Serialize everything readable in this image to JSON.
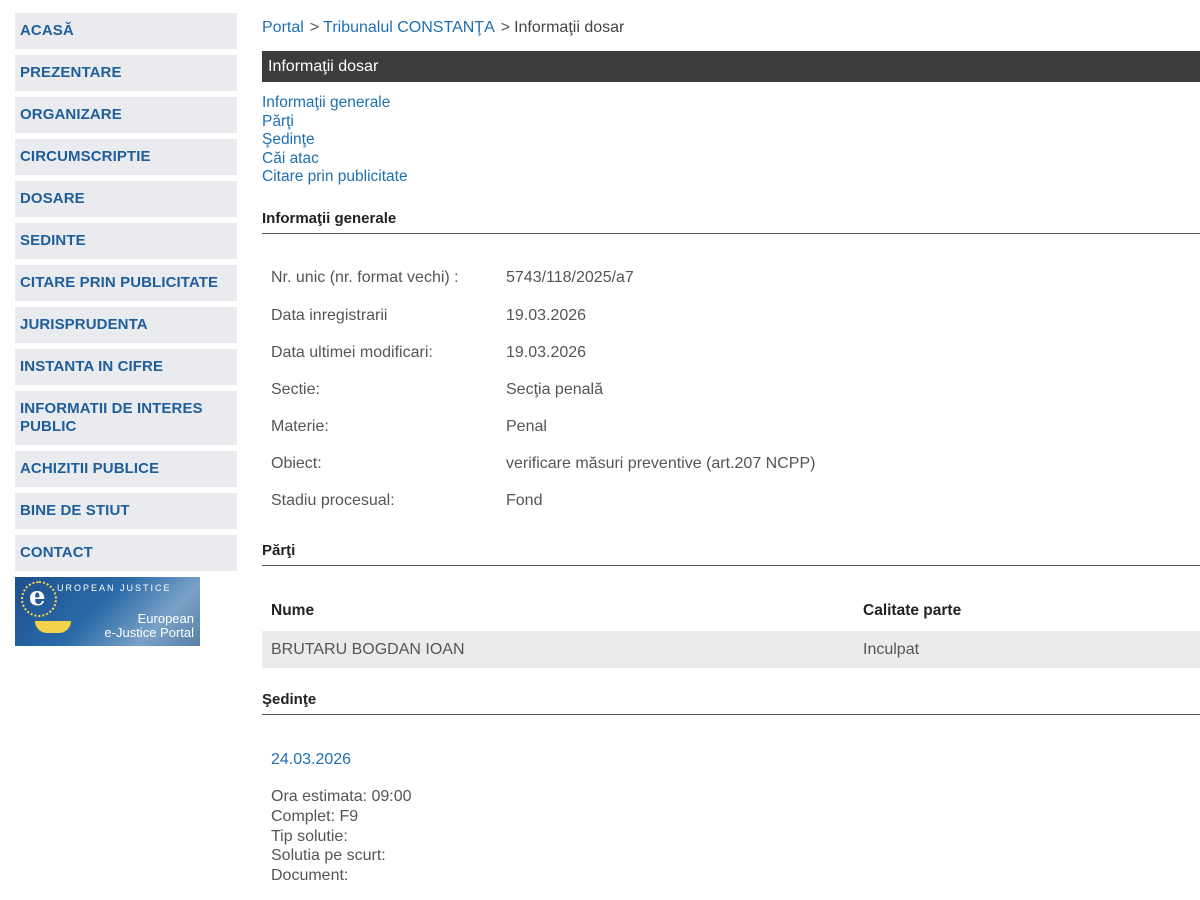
{
  "sidebar": {
    "items": [
      {
        "label": "ACASĂ"
      },
      {
        "label": "PREZENTARE"
      },
      {
        "label": "ORGANIZARE"
      },
      {
        "label": "CIRCUMSCRIPTIE"
      },
      {
        "label": "DOSARE"
      },
      {
        "label": "SEDINTE"
      },
      {
        "label": "CITARE PRIN PUBLICITATE"
      },
      {
        "label": "JURISPRUDENTA"
      },
      {
        "label": "INSTANTA IN CIFRE"
      },
      {
        "label": "INFORMATII DE INTERES PUBLIC"
      },
      {
        "label": "ACHIZITII PUBLICE"
      },
      {
        "label": "BINE DE STIUT"
      },
      {
        "label": "CONTACT"
      }
    ],
    "banner": {
      "top_text": "UROPEAN JUSTICE",
      "e_letter": "e",
      "line1": "European",
      "line2": "e-Justice Portal"
    }
  },
  "breadcrumb": {
    "portal": "Portal",
    "sep": ">",
    "court": "Tribunalul CONSTANŢA",
    "current": "Informaţii dosar"
  },
  "title": "Informaţii dosar",
  "anchors": [
    "Informaţii generale",
    "Părţi",
    "Şedinţe",
    "Căi atac",
    "Citare prin publicitate"
  ],
  "general": {
    "heading": "Informaţii generale",
    "rows": [
      {
        "label": "Nr. unic (nr. format vechi) :",
        "value": "5743/118/2025/a7"
      },
      {
        "label": "Data inregistrarii",
        "value": "19.03.2026"
      },
      {
        "label": "Data ultimei modificari:",
        "value": "19.03.2026"
      },
      {
        "label": "Sectie:",
        "value": "Secţia penală"
      },
      {
        "label": "Materie:",
        "value": "Penal"
      },
      {
        "label": "Obiect:",
        "value": "verificare măsuri preventive (art.207 NCPP)"
      },
      {
        "label": "Stadiu procesual:",
        "value": "Fond"
      }
    ]
  },
  "parti": {
    "heading": "Părţi",
    "columns": [
      "Nume",
      "Calitate parte"
    ],
    "rows": [
      [
        "BRUTARU BOGDAN IOAN",
        "Inculpat"
      ]
    ]
  },
  "sedinte": {
    "heading": "Şedinţe",
    "date": "24.03.2026",
    "details": [
      "Ora estimata: 09:00",
      "Complet: F9",
      "Tip solutie:",
      "Solutia pe scurt:",
      "Document:"
    ]
  }
}
